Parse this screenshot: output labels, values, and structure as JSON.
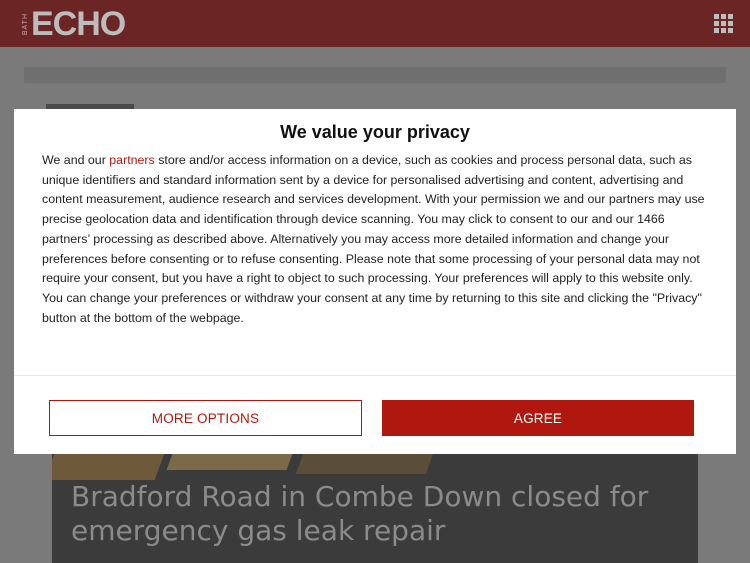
{
  "header": {
    "logo_small": "BATH",
    "logo_main": "ECHO",
    "menu_icon": "grid-menu-icon"
  },
  "article": {
    "headline": "Bradford Road in Combe Down closed for emergency gas leak repair"
  },
  "consent": {
    "title": "We value your privacy",
    "body_before_link": "We and our ",
    "link_text": "partners",
    "body_after_link": " store and/or access information on a device, such as cookies and process personal data, such as unique identifiers and standard information sent by a device for personalised advertising and content, advertising and content measurement, audience research and services development. With your permission we and our partners may use precise geolocation data and identification through device scanning. You may click to consent to our and our 1466 partners’ processing as described above. Alternatively you may access more detailed information and change your preferences before consenting or to refuse consenting. Please note that some processing of your personal data may not require your consent, but you have a right to object to such processing. Your preferences will apply to this website only. You can change your preferences or withdraw your consent at any time by returning to this site and clicking the \"Privacy\" button at the bottom of the webpage.",
    "more_options_label": "MORE OPTIONS",
    "agree_label": "AGREE"
  },
  "colors": {
    "brand_red": "#b0180f",
    "header_bg": "#6b2525"
  }
}
